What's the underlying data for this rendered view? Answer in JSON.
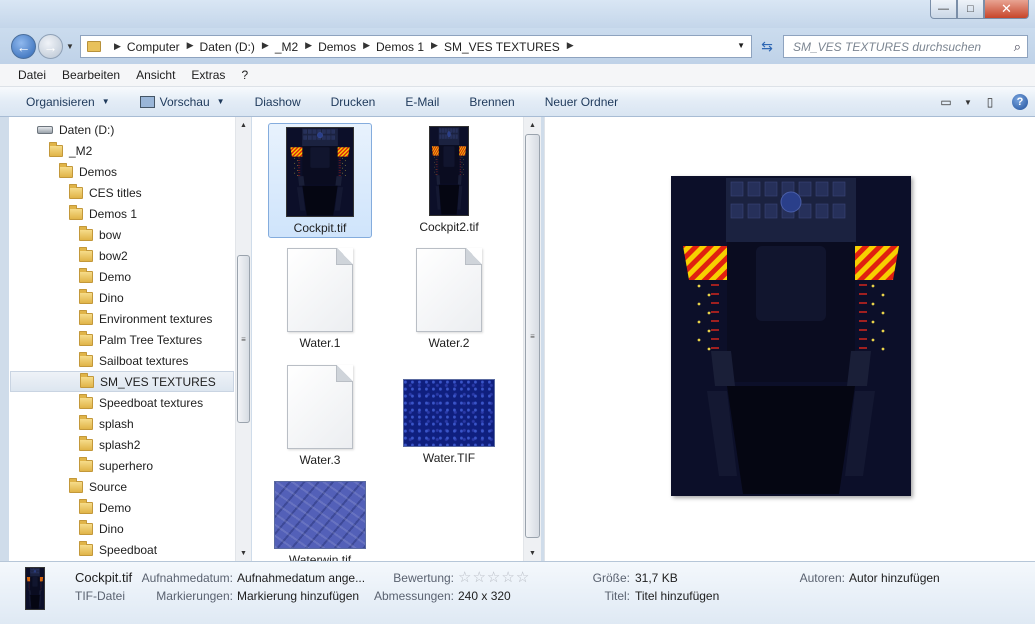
{
  "window": {
    "minimize_glyph": "—",
    "maximize_glyph": "□",
    "close_glyph": "✕"
  },
  "address": {
    "crumbs": [
      "Computer",
      "Daten (D:)",
      "_M2",
      "Demos",
      "Demos 1",
      "SM_VES TEXTURES"
    ],
    "search_placeholder": "SM_VES TEXTURES durchsuchen"
  },
  "menu": [
    "Datei",
    "Bearbeiten",
    "Ansicht",
    "Extras",
    "?"
  ],
  "toolbar": {
    "organize": "Organisieren",
    "preview": "Vorschau",
    "slideshow": "Diashow",
    "print": "Drucken",
    "email": "E-Mail",
    "burn": "Brennen",
    "new_folder": "Neuer Ordner"
  },
  "tree": [
    {
      "label": "Daten (D:)",
      "icon": "drive-icon",
      "indent": 0
    },
    {
      "label": "_M2",
      "icon": "folder-icon",
      "indent": 1
    },
    {
      "label": "Demos",
      "icon": "folder-icon",
      "indent": 2
    },
    {
      "label": "CES titles",
      "icon": "folder-icon",
      "indent": 3
    },
    {
      "label": "Demos 1",
      "icon": "folder-icon",
      "indent": 3
    },
    {
      "label": "bow",
      "icon": "folder-icon",
      "indent": 4
    },
    {
      "label": "bow2",
      "icon": "folder-icon",
      "indent": 4
    },
    {
      "label": "Demo",
      "icon": "folder-icon",
      "indent": 4
    },
    {
      "label": "Dino",
      "icon": "folder-icon",
      "indent": 4
    },
    {
      "label": "Environment textures",
      "icon": "folder-icon",
      "indent": 4
    },
    {
      "label": "Palm Tree Textures",
      "icon": "folder-icon",
      "indent": 4
    },
    {
      "label": "Sailboat textures",
      "icon": "folder-icon",
      "indent": 4
    },
    {
      "label": "SM_VES TEXTURES",
      "icon": "folder-icon",
      "indent": 4,
      "selected": true
    },
    {
      "label": "Speedboat textures",
      "icon": "folder-icon",
      "indent": 4
    },
    {
      "label": "splash",
      "icon": "folder-icon",
      "indent": 4
    },
    {
      "label": "splash2",
      "icon": "folder-icon",
      "indent": 4
    },
    {
      "label": "superhero",
      "icon": "folder-icon",
      "indent": 4
    },
    {
      "label": "Source",
      "icon": "folder-icon",
      "indent": 3
    },
    {
      "label": "Demo",
      "icon": "folder-icon",
      "indent": 4
    },
    {
      "label": "Dino",
      "icon": "folder-icon",
      "indent": 4
    },
    {
      "label": "Speedboat",
      "icon": "folder-icon",
      "indent": 4
    }
  ],
  "files": [
    {
      "name": "Cockpit.tif",
      "thumb": "cockpit",
      "selected": true
    },
    {
      "name": "Cockpit2.tif",
      "thumb": "cockpit-narrow"
    },
    {
      "name": "Water.1",
      "thumb": "doc"
    },
    {
      "name": "Water.2",
      "thumb": "doc"
    },
    {
      "name": "Water.3",
      "thumb": "doc"
    },
    {
      "name": "Water.TIF",
      "thumb": "water-tif"
    },
    {
      "name": "Waterwin.tif",
      "thumb": "waterwin"
    }
  ],
  "details": {
    "filename": "Cockpit.tif",
    "filetype": "TIF-Datei",
    "date_label": "Aufnahmedatum:",
    "date_value": "Aufnahmedatum ange...",
    "tags_label": "Markierungen:",
    "tags_value": "Markierung hinzufügen",
    "rating_label": "Bewertung:",
    "rating_stars": 0,
    "dimensions_label": "Abmessungen:",
    "dimensions_value": "240 x 320",
    "size_label": "Größe:",
    "size_value": "31,7 KB",
    "title_label": "Titel:",
    "title_value": "Titel hinzufügen",
    "authors_label": "Autoren:",
    "authors_value": "Autor hinzufügen"
  },
  "colors": {
    "hazard_yellow": "#f7d000",
    "hazard_red": "#e02010",
    "cockpit_bg": "#0c0f29",
    "selection": "#cfe4fb"
  }
}
